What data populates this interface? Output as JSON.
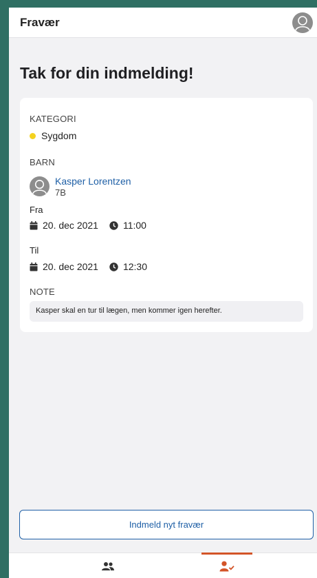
{
  "header": {
    "title": "Fravær"
  },
  "main": {
    "heading": "Tak for din indmelding!"
  },
  "card": {
    "category": {
      "label": "KATEGORI",
      "value": "Sygdom",
      "dot_color": "#f4d21f"
    },
    "child": {
      "label": "BARN",
      "name": "Kasper Lorentzen",
      "class": "7B"
    },
    "from": {
      "label": "Fra",
      "date": "20. dec 2021",
      "time": "11:00"
    },
    "to": {
      "label": "Til",
      "date": "20. dec 2021",
      "time": "12:30"
    },
    "note": {
      "label": "NOTE",
      "text": "Kasper skal en tur til lægen, men kommer igen herefter."
    }
  },
  "actions": {
    "new_absence_label": "Indmeld nyt fravær"
  },
  "tabbar": {
    "items": [
      {
        "icon": "people-icon",
        "active": false
      },
      {
        "icon": "user-check-icon",
        "active": true
      }
    ],
    "accent_color": "#d35428"
  },
  "colors": {
    "link": "#1e5fa6",
    "frame": "#2f6f63"
  }
}
